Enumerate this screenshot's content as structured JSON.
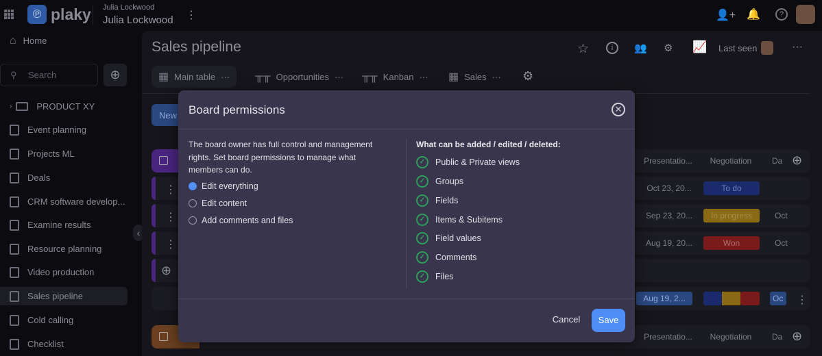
{
  "topbar": {
    "brand": "plaky",
    "workspace_small": "Julia Lockwood",
    "workspace": "Julia Lockwood"
  },
  "sidebar": {
    "home": "Home",
    "search_placeholder": "Search",
    "items": [
      {
        "label": "PRODUCT XY"
      },
      {
        "label": "Event planning"
      },
      {
        "label": "Projects ML"
      },
      {
        "label": "Deals"
      },
      {
        "label": "CRM software develop..."
      },
      {
        "label": "Examine results"
      },
      {
        "label": "Resource planning"
      },
      {
        "label": "Video production"
      },
      {
        "label": "Sales pipeline"
      },
      {
        "label": "Cold calling"
      },
      {
        "label": "Checklist"
      }
    ]
  },
  "board": {
    "title": "Sales pipeline",
    "last_seen": "Last seen",
    "new_label": "New",
    "tabs": [
      {
        "label": "Main table"
      },
      {
        "label": "Opportunities"
      },
      {
        "label": "Kanban"
      },
      {
        "label": "Sales"
      }
    ],
    "columns": {
      "presentation": "Presentatio...",
      "negotiation": "Negotiation",
      "date": "Da"
    },
    "rows": [
      {
        "date": "Oct 23, 20...",
        "status": "To do",
        "status_color": "#1a2a6c",
        "due": ""
      },
      {
        "date": "Sep 23, 20...",
        "status": "In progress",
        "status_color": "#8a6a14",
        "due": "Oct"
      },
      {
        "date": "Aug 19, 20...",
        "status": "Won",
        "status_color": "#7a1a1a",
        "due": "Oct"
      }
    ],
    "summary": {
      "date": "Aug 19, 2...",
      "due": "Oc"
    }
  },
  "modal": {
    "title": "Board permissions",
    "description": "The board owner has full control and management rights. Set board permissions to manage what members can do.",
    "options": [
      {
        "label": "Edit everything",
        "selected": true
      },
      {
        "label": "Edit content",
        "selected": false
      },
      {
        "label": "Add comments and files",
        "selected": false
      }
    ],
    "what_heading": "What can be added / edited / deleted:",
    "permissions": [
      "Public & Private views",
      "Groups",
      "Fields",
      "Items & Subitems",
      "Field values",
      "Comments",
      "Files"
    ],
    "cancel": "Cancel",
    "save": "Save"
  },
  "colors": {
    "accent": "#4f8ef7",
    "check": "#2e9e5b"
  }
}
